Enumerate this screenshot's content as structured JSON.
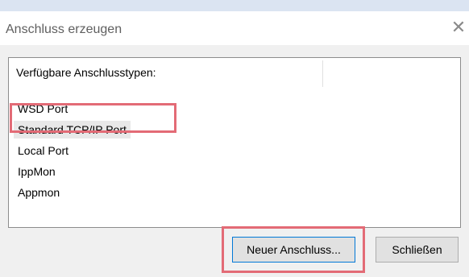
{
  "dialog": {
    "title": "Anschluss erzeugen",
    "close_glyph": "✕"
  },
  "list": {
    "header": "Verfügbare Anschlusstypen:",
    "items": [
      {
        "label": "WSD Port",
        "selected": false
      },
      {
        "label": "Standard TCP/IP Port",
        "selected": true
      },
      {
        "label": "Local Port",
        "selected": false
      },
      {
        "label": "IppMon",
        "selected": false
      },
      {
        "label": "Appmon",
        "selected": false
      }
    ]
  },
  "buttons": {
    "new_port": "Neuer Anschluss...",
    "close": "Schließen"
  },
  "colors": {
    "highlight": "#e36b76",
    "selection": "#e8e8e8"
  },
  "icons": {
    "close": "close-icon"
  }
}
